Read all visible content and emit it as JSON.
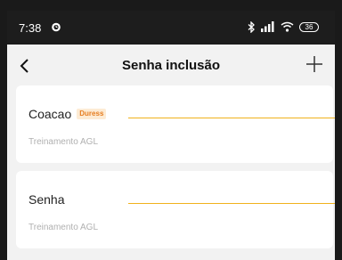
{
  "status_bar": {
    "time": "7:38",
    "battery": "36"
  },
  "header": {
    "title": "Senha inclusão"
  },
  "entries": [
    {
      "name": "Coacao",
      "badge": "Duress",
      "subtitle": "Treinamento AGL"
    },
    {
      "name": "Senha",
      "badge": "",
      "subtitle": "Treinamento AGL"
    }
  ],
  "colors": {
    "accent_line": "#f0b21c",
    "badge_text": "#e67e22",
    "badge_bg": "#fdebd4"
  }
}
